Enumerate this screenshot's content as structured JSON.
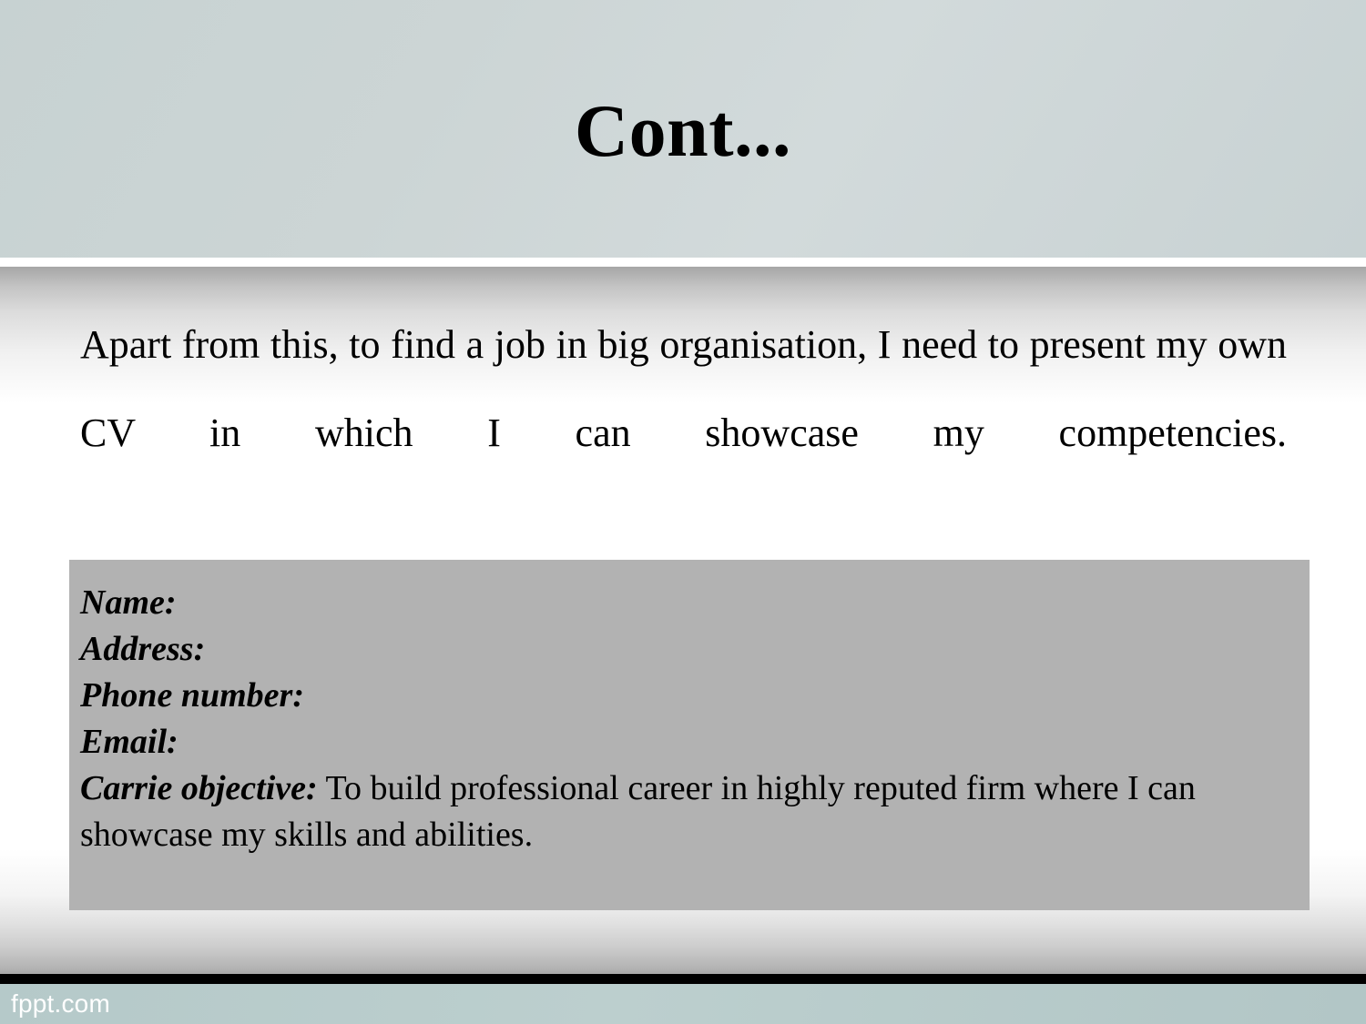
{
  "slide": {
    "title": "Cont...",
    "body_paragraph": "Apart from this, to find a job in big organisation, I need to present my own CV in which I can showcase my competencies.",
    "cv_box": {
      "lines": [
        {
          "label": "Name:",
          "value": ""
        },
        {
          "label": "Address:",
          "value": ""
        },
        {
          "label": "Phone number:",
          "value": ""
        },
        {
          "label": "Email:",
          "value": ""
        }
      ],
      "objective_label": "Carrie objective:",
      "objective_value": " To build professional career in highly reputed firm where I can showcase my skills and abilities."
    },
    "footer": {
      "watermark": "fppt.com"
    },
    "colors": {
      "header_background": "#ccd5d5",
      "cv_box_background": "#b2b2b2",
      "footer_band": "#b5c9c9",
      "footer_rule": "#000000",
      "text": "#000000",
      "watermark_text": "#ffffff"
    }
  }
}
